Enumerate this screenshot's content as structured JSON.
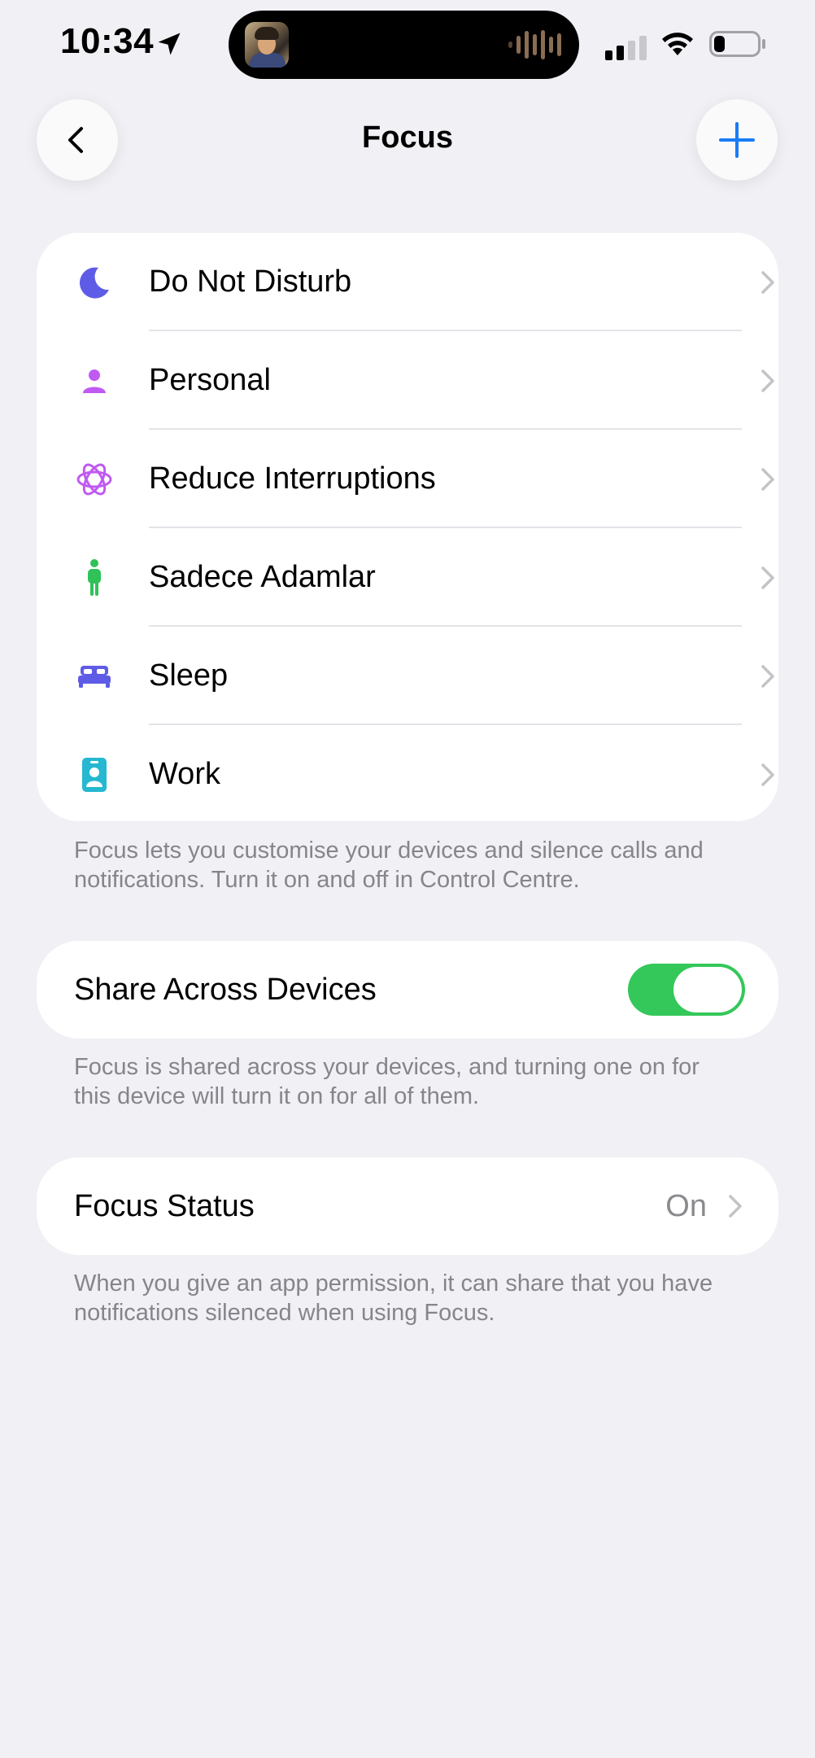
{
  "status_bar": {
    "time": "10:34",
    "location_icon": "location-arrow-icon",
    "signal_icon": "cellular-signal-icon",
    "wifi_icon": "wifi-icon",
    "battery_icon": "battery-icon",
    "battery_level": 0.25
  },
  "nav": {
    "title": "Focus",
    "back_icon": "chevron-left-icon",
    "add_icon": "plus-icon",
    "accent_color": "#1a7cf5"
  },
  "focus_modes": [
    {
      "label": "Do Not Disturb",
      "icon": "moon-icon",
      "color": "#5e5ce6"
    },
    {
      "label": "Personal",
      "icon": "person-icon",
      "color": "#bf5af2"
    },
    {
      "label": "Reduce Interruptions",
      "icon": "interruptions-icon",
      "color": "#bf5af2"
    },
    {
      "label": "Sadece Adamlar",
      "icon": "standing-person-icon",
      "color": "#30c158"
    },
    {
      "label": "Sleep",
      "icon": "bed-icon",
      "color": "#5e5ce6"
    },
    {
      "label": "Work",
      "icon": "id-badge-icon",
      "color": "#25b8d0"
    }
  ],
  "focus_footnote": "Focus lets you customise your devices and silence calls and notifications. Turn it on and off in Control Centre.",
  "share": {
    "label": "Share Across Devices",
    "enabled": true,
    "toggle_color": "#34c759",
    "footnote": "Focus is shared across your devices, and turning one on for this device will turn it on for all of them."
  },
  "focus_status": {
    "label": "Focus Status",
    "value": "On",
    "footnote": "When you give an app permission, it can share that you have notifications silenced when using Focus."
  }
}
